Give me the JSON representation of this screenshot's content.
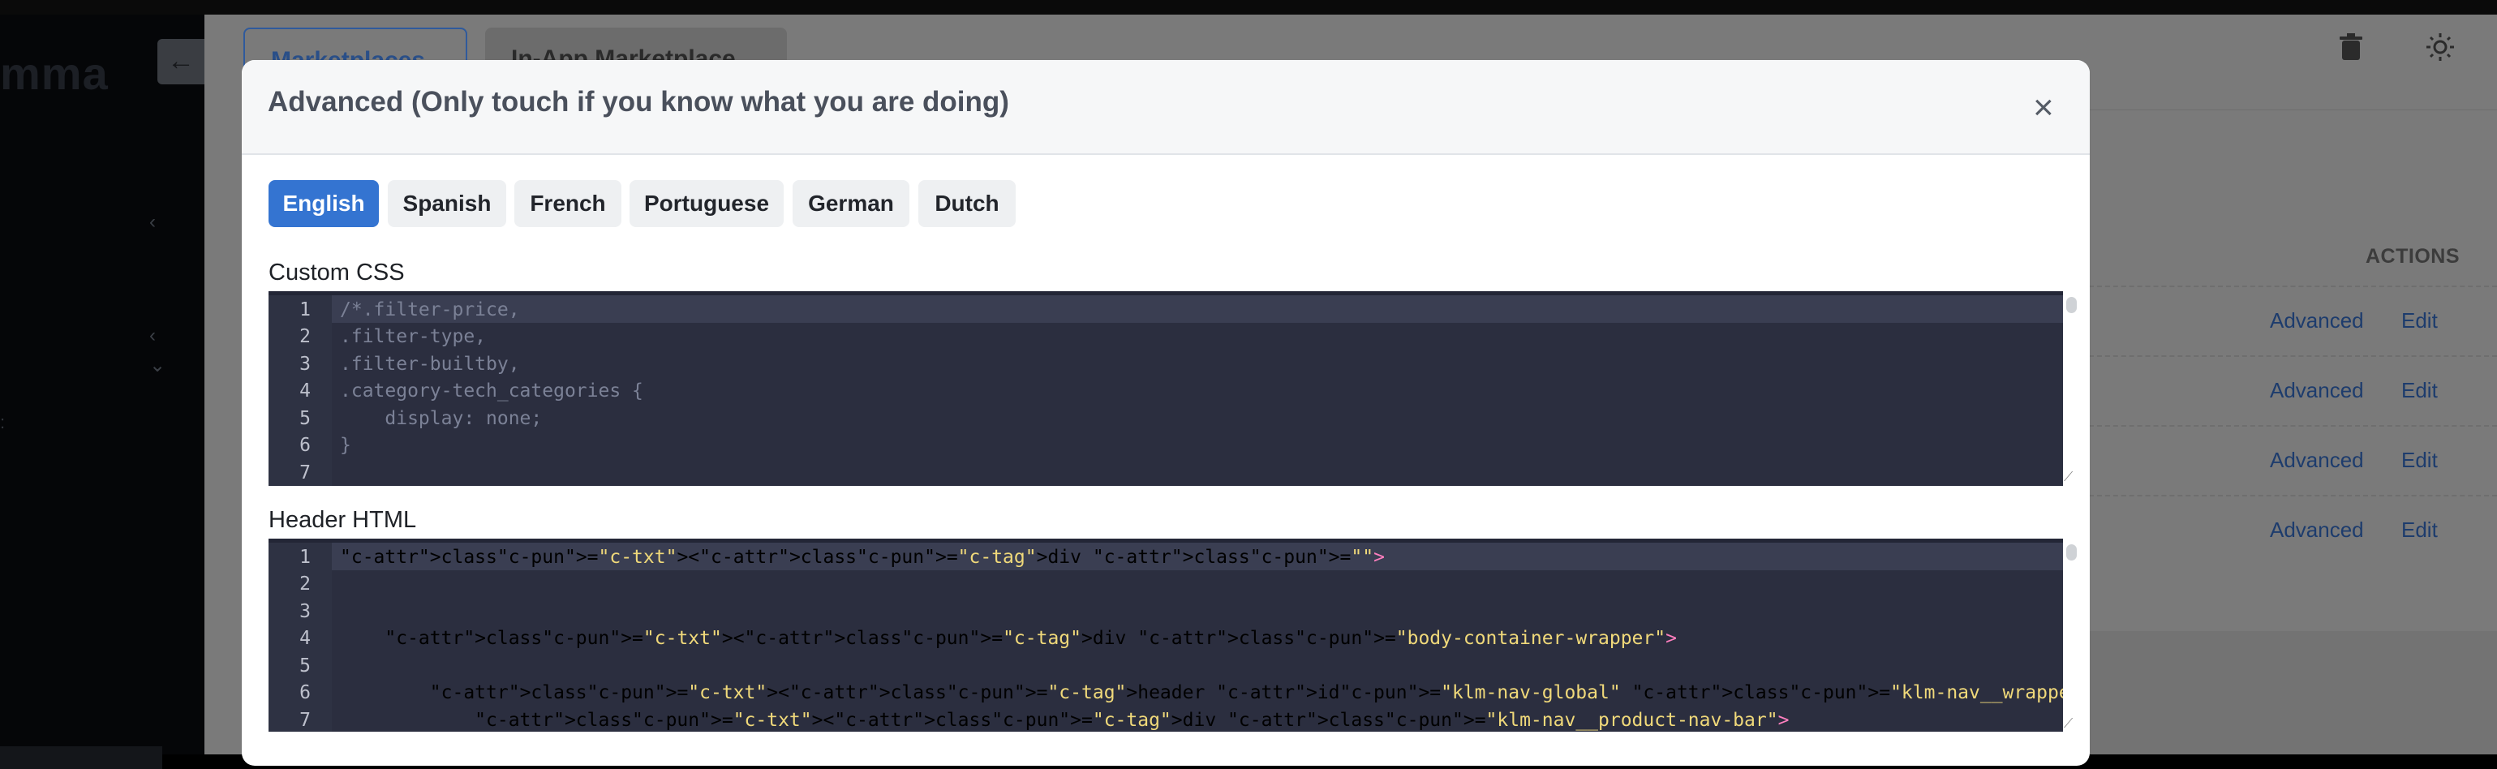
{
  "brand": {
    "text": "mma"
  },
  "background": {
    "tabs": [
      "Marketplaces",
      "In-App Marketplace"
    ],
    "actions_header": "ACTIONS",
    "rows": [
      {
        "advanced": "Advanced",
        "edit": "Edit"
      },
      {
        "advanced": "Advanced",
        "edit": "Edit"
      },
      {
        "advanced": "Advanced",
        "edit": "Edit"
      },
      {
        "advanced": "Advanced",
        "edit": "Edit"
      }
    ]
  },
  "modal": {
    "title": "Advanced (Only touch if you know what you are doing)",
    "close_glyph": "×",
    "languages": [
      "English",
      "Spanish",
      "French",
      "Portuguese",
      "German",
      "Dutch"
    ],
    "active_language": "English",
    "css_label": "Custom CSS",
    "css_lines": [
      "/*.filter-price,",
      ".filter-type,",
      ".filter-builtby,",
      ".category-tech_categories {",
      "    display: none;",
      "}",
      ""
    ],
    "html_label": "Header HTML",
    "html_lines": [
      "<div class=\"\">",
      "",
      "",
      "    <div class=\"body-container-wrapper\">",
      "",
      "        <header id=\"klm-nav-global\" class=\"klm-nav__wrapper\">",
      "            <div class=\"klm-nav__product-nav-bar\">"
    ]
  },
  "colors": {
    "accent": "#3474d1",
    "link": "#1d3c6d",
    "editor_bg": "#2b2e3f"
  },
  "icons": {
    "back": "arrow-left-icon",
    "trash": "trash-icon",
    "theme": "sun-icon",
    "close": "close-icon"
  }
}
